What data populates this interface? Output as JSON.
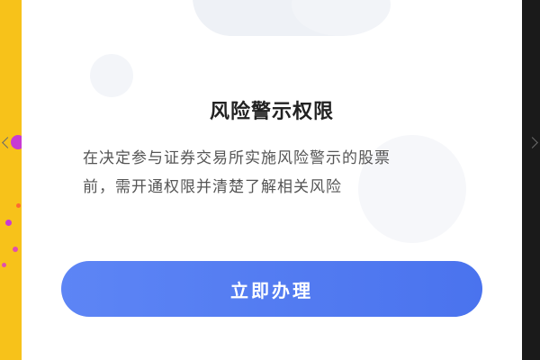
{
  "modal": {
    "title": "风险警示权限",
    "description_lines": [
      "在决定参与证券交易所实施风险警示的股票",
      "前，需开通权限并清楚了解相关风险"
    ],
    "action_label": "立即办理"
  },
  "colors": {
    "accent": "#4f78f0",
    "background_left": "#f7c21a",
    "background_right": "#1a1a1a"
  },
  "icons": {
    "left_edge": "chevron-left-icon",
    "right_edge": "chevron-right-icon"
  }
}
